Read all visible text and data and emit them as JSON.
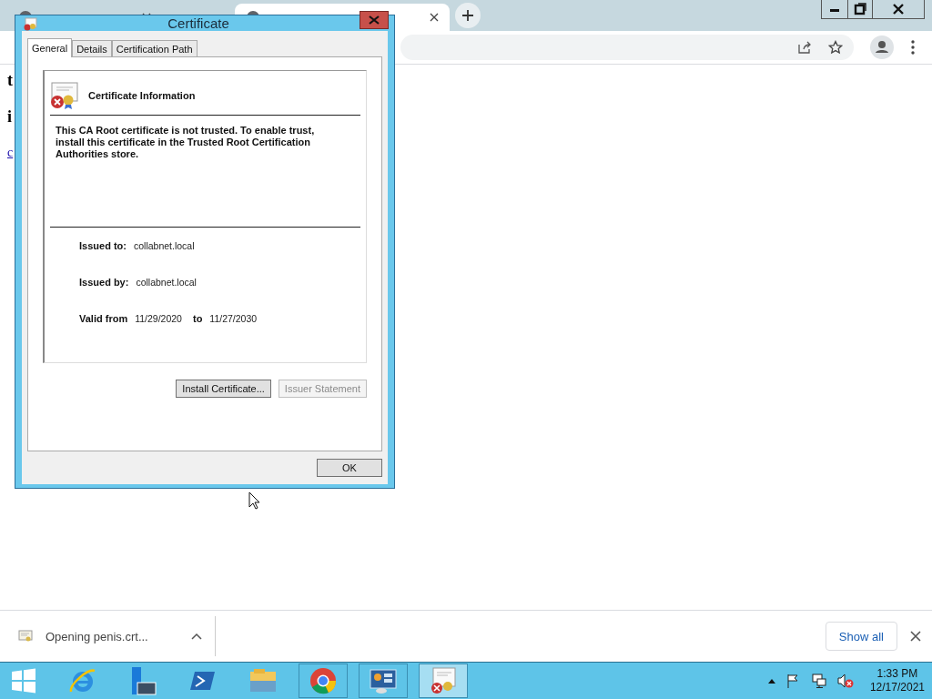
{
  "browser": {
    "tabs": [
      {
        "selected": false
      },
      {
        "selected": true
      }
    ],
    "page_lines": [
      {
        "text": "t",
        "kind": "heading"
      },
      {
        "text": "i",
        "kind": "heading"
      },
      {
        "text": "c",
        "kind": "link"
      }
    ]
  },
  "dialog": {
    "title": "Certificate",
    "tabs": [
      {
        "label": "General",
        "selected": true
      },
      {
        "label": "Details",
        "selected": false
      },
      {
        "label": "Certification Path",
        "selected": false
      }
    ],
    "heading": "Certificate Information",
    "message": "This CA Root certificate is not trusted. To enable trust, install this certificate in the Trusted Root Certification Authorities store.",
    "fields": [
      {
        "label": "Issued to:",
        "value": "collabnet.local"
      },
      {
        "label": "Issued by:",
        "value": "collabnet.local"
      }
    ],
    "validity": {
      "label": "Valid from",
      "from": "11/29/2020",
      "to_label": "to",
      "to": "11/27/2030"
    },
    "buttons": [
      {
        "label": "Install Certificate...",
        "disabled": false
      },
      {
        "label": "Issuer Statement",
        "disabled": true
      }
    ],
    "ok": "OK"
  },
  "downloads": {
    "item": "Opening penis.crt...",
    "show_all": "Show all"
  },
  "taskbar": {
    "apps": [
      {
        "kind": "ie",
        "running": false,
        "selected": false
      },
      {
        "kind": "server",
        "running": false,
        "selected": false
      },
      {
        "kind": "powershell",
        "running": false,
        "selected": false
      },
      {
        "kind": "explorer",
        "running": false,
        "selected": false
      },
      {
        "kind": "chrome",
        "running": true,
        "selected": false
      },
      {
        "kind": "control",
        "running": true,
        "selected": false
      },
      {
        "kind": "certificate",
        "running": true,
        "selected": true
      }
    ],
    "clock_time": "1:33 PM",
    "clock_date": "12/17/2021"
  }
}
